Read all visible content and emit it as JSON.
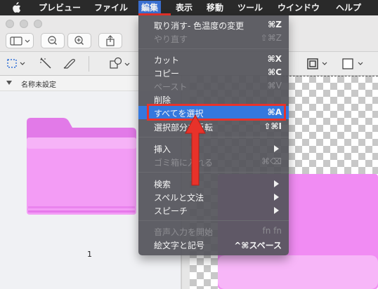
{
  "menubar": {
    "items": [
      "プレビュー",
      "ファイル",
      "編集",
      "表示",
      "移動",
      "ツール",
      "ウインドウ",
      "ヘルプ"
    ]
  },
  "sidebar": {
    "header": "名称未設定",
    "page_number": "1"
  },
  "edit_menu": {
    "rows": [
      {
        "label": "取り消す- 色温度の変更",
        "shortcut": "⌘Z",
        "enabled": true
      },
      {
        "label": "やり直す",
        "shortcut": "⇧⌘Z",
        "enabled": false
      },
      {
        "label": "カット",
        "shortcut": "⌘X",
        "enabled": true
      },
      {
        "label": "コピー",
        "shortcut": "⌘C",
        "enabled": true
      },
      {
        "label": "ペースト",
        "shortcut": "⌘V",
        "enabled": false
      },
      {
        "label": "削除",
        "shortcut": "",
        "enabled": true
      },
      {
        "label": "すべてを選択",
        "shortcut": "⌘A",
        "enabled": true,
        "highlighted": true
      },
      {
        "label": "選択部分を反転",
        "shortcut": "⇧⌘I",
        "enabled": true
      },
      {
        "label": "挿入",
        "shortcut": "",
        "enabled": true,
        "submenu": true
      },
      {
        "label": "ゴミ箱に入れる",
        "shortcut": "⌘⌫",
        "enabled": false
      },
      {
        "label": "検索",
        "shortcut": "",
        "enabled": true,
        "submenu": true
      },
      {
        "label": "スペルと文法",
        "shortcut": "",
        "enabled": true,
        "submenu": true
      },
      {
        "label": "スピーチ",
        "shortcut": "",
        "enabled": true,
        "submenu": true
      },
      {
        "label": "音声入力を開始",
        "shortcut": "fn fn",
        "enabled": false
      },
      {
        "label": "絵文字と記号",
        "shortcut": "^⌘スペース",
        "enabled": true
      }
    ]
  },
  "colors": {
    "accent": "#3478de",
    "annotation": "#e8322a",
    "folder": "#f18cf3"
  }
}
